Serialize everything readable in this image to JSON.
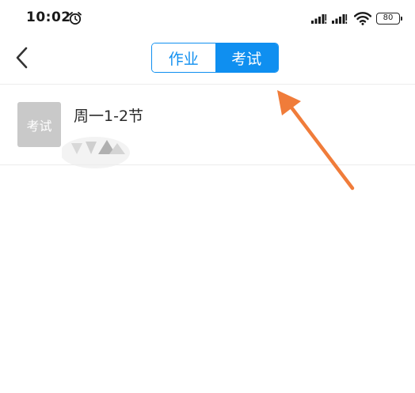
{
  "status_bar": {
    "time": "10:02",
    "battery": "80",
    "icons": [
      "alarm-icon",
      "signal-icon",
      "signal-icon",
      "wifi-icon",
      "battery-icon"
    ]
  },
  "nav": {
    "back_icon": "chevron-left-icon",
    "tabs": [
      {
        "label": "作业",
        "selected": false
      },
      {
        "label": "考试",
        "selected": true
      }
    ]
  },
  "list": {
    "items": [
      {
        "badge": "考试",
        "title": "周一1-2节"
      }
    ]
  },
  "colors": {
    "accent": "#0f8ff0",
    "badge_bg": "#c9c9c9",
    "annotation_arrow": "#f07c3a",
    "divider": "#ececec"
  }
}
